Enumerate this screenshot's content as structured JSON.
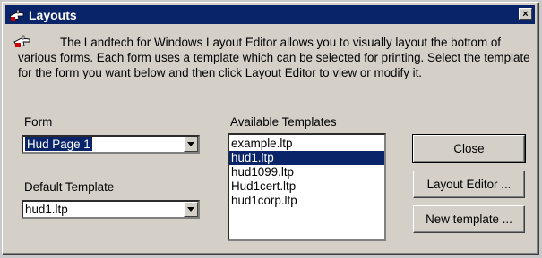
{
  "window": {
    "title": "Layouts",
    "close_glyph": "×",
    "description": "The Landtech for Windows Layout Editor allows you to visually layout the bottom of various forms. Each form uses a template which can be selected for printing. Select the template for the form you want below and then click Layout Editor to view or modify it."
  },
  "form": {
    "label": "Form",
    "value": "Hud Page 1"
  },
  "default_template": {
    "label": "Default Template",
    "value": "hud1.ltp"
  },
  "available_templates": {
    "label": "Available Templates",
    "items": [
      "example.ltp",
      "hud1.ltp",
      "hud1099.ltp",
      "Hud1cert.ltp",
      "hud1corp.ltp"
    ],
    "selected_index": 1
  },
  "buttons": {
    "close": "Close",
    "layout_editor": "Layout Editor ...",
    "new_template": "New template ..."
  },
  "icons": {
    "title": "pointing-hand-icon",
    "description": "pointing-hand-icon",
    "dropdown": "chevron-down-icon"
  }
}
